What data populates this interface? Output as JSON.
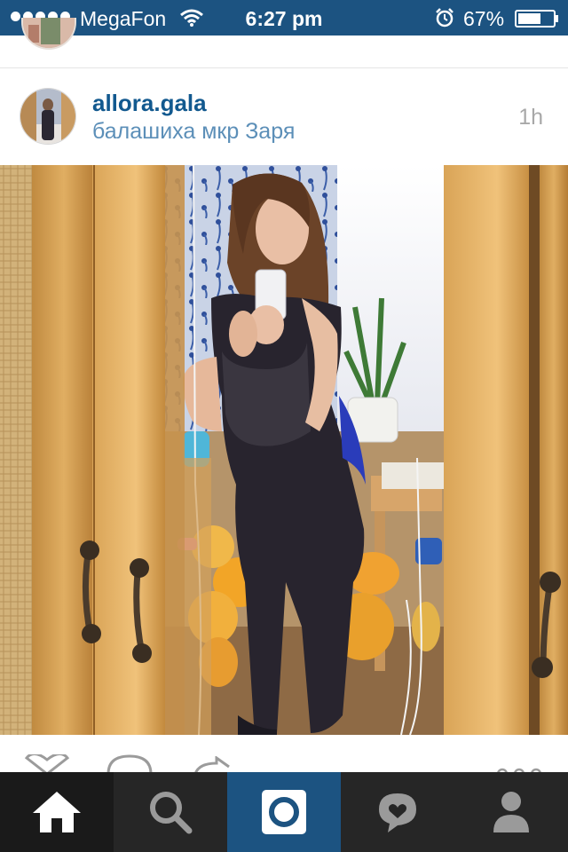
{
  "status_bar": {
    "carrier": "MegaFon",
    "time": "6:27 pm",
    "battery": "67%",
    "signal_bars": 5,
    "battery_level": 0.67,
    "background_color": "#1c5381"
  },
  "post": {
    "username": "allora.gala",
    "location": "балашиха мкр Заря",
    "time_ago": "1h",
    "username_color": "#12598f",
    "location_color": "#5c8fb8"
  },
  "actions": {
    "icons": [
      "like-icon",
      "comment-icon",
      "share-icon",
      "more-icon"
    ]
  },
  "tab_bar": {
    "tabs": [
      "home-icon",
      "search-icon",
      "camera-icon",
      "activity-icon",
      "profile-icon"
    ],
    "active_tab": "home-icon",
    "accent_color": "#1c5381"
  }
}
